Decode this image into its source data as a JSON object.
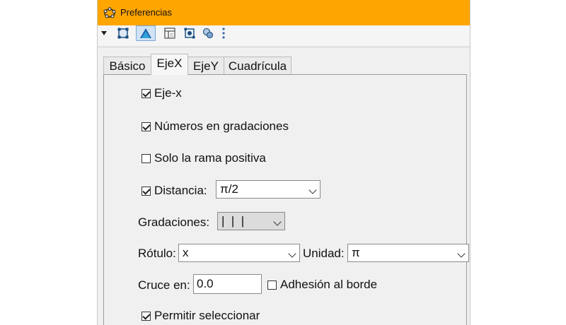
{
  "window": {
    "title": "Preferencias",
    "accent_color": "#ffa500"
  },
  "toolbar": {
    "icons": [
      "menu-arrow-icon",
      "graphics-view-icon",
      "triangle-view-icon",
      "layout-icon",
      "settings-icon",
      "tools-icon",
      "more-icon"
    ]
  },
  "tabs": [
    {
      "label": "Básico",
      "active": false
    },
    {
      "label": "EjeX",
      "active": true
    },
    {
      "label": "EjeY",
      "active": false
    },
    {
      "label": "Cuadrícula",
      "active": false
    }
  ],
  "options": {
    "eje_x": {
      "label": "Eje-x",
      "checked": true
    },
    "numeros": {
      "label": "Números en gradaciones",
      "checked": true
    },
    "solo_positiva": {
      "label": "Solo la rama positiva",
      "checked": false
    },
    "distancia": {
      "label": "Distancia:",
      "checked": true,
      "value": "π/2"
    },
    "gradaciones": {
      "label": "Gradaciones:",
      "value": "|  |  |"
    },
    "rotulo": {
      "label": "Rótulo:",
      "value": "x"
    },
    "unidad": {
      "label": "Unidad:",
      "value": "π"
    },
    "cruce": {
      "label": "Cruce en:",
      "value": "0.0"
    },
    "adhesion": {
      "label": "Adhesión al borde",
      "checked": false
    },
    "permitir": {
      "label": "Permitir seleccionar",
      "checked": true
    }
  }
}
